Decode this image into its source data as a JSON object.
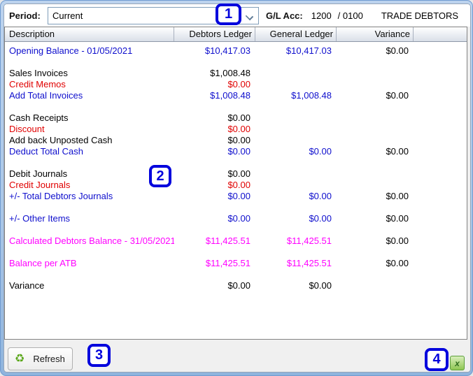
{
  "window": {
    "colors": {
      "blue": "#0e0ecd",
      "red": "#e00000",
      "magenta": "#ff00ff",
      "black": "#000000",
      "annotation": "#0202dd",
      "refresh_icon_green": "#58a618"
    },
    "topbar": {
      "period_label": "Period:",
      "period_value": "Current",
      "gl_acc_label": "G/L Acc:",
      "gl_acc_value": "1200",
      "gl_acc_sub": "/ 0100",
      "gl_acc_name": "TRADE DEBTORS"
    },
    "table": {
      "columns": [
        "Description",
        "Debtors Ledger",
        "General Ledger",
        "Variance"
      ],
      "rows": [
        {
          "label": "Opening Balance - 01/05/2021",
          "style": "blue",
          "debtors": "$10,417.03",
          "general": "$10,417.03",
          "variance": "$0.00"
        },
        {
          "spacer": true
        },
        {
          "label": "Sales Invoices",
          "style": "black",
          "debtors": "$1,008.48"
        },
        {
          "label": "Credit Memos",
          "style": "red",
          "debtors": "$0.00"
        },
        {
          "label": "Add Total Invoices",
          "style": "blue",
          "debtors": "$1,008.48",
          "general": "$1,008.48",
          "variance": "$0.00"
        },
        {
          "spacer": true
        },
        {
          "label": "Cash Receipts",
          "style": "black",
          "debtors": "$0.00"
        },
        {
          "label": "Discount",
          "style": "red",
          "debtors": "$0.00"
        },
        {
          "label": "Add back Unposted Cash",
          "style": "black",
          "debtors": "$0.00"
        },
        {
          "label": "Deduct Total Cash",
          "style": "blue",
          "debtors": "$0.00",
          "general": "$0.00",
          "variance": "$0.00"
        },
        {
          "spacer": true
        },
        {
          "label": "Debit Journals",
          "style": "black",
          "debtors": "$0.00"
        },
        {
          "label": "Credit Journals",
          "style": "red",
          "debtors": "$0.00"
        },
        {
          "label": "+/- Total Debtors Journals",
          "style": "blue",
          "debtors": "$0.00",
          "general": "$0.00",
          "variance": "$0.00"
        },
        {
          "spacer": true
        },
        {
          "label": "+/- Other Items",
          "style": "blue",
          "debtors": "$0.00",
          "general": "$0.00",
          "variance": "$0.00"
        },
        {
          "spacer": true
        },
        {
          "label": "Calculated Debtors Balance - 31/05/2021",
          "style": "magenta",
          "debtors": "$11,425.51",
          "general": "$11,425.51",
          "variance": "$0.00"
        },
        {
          "spacer": true
        },
        {
          "label": "Balance per ATB",
          "style": "magenta",
          "debtors": "$11,425.51",
          "general": "$11,425.51",
          "variance": "$0.00"
        },
        {
          "spacer": true
        },
        {
          "label": "Variance",
          "style": "black",
          "debtors": "$0.00",
          "general": "$0.00"
        }
      ]
    },
    "footer": {
      "refresh_label": "Refresh",
      "refresh_icon": "recycle-icon",
      "export_icon": "excel-export-icon",
      "excel_glyph": "x"
    },
    "annotations": {
      "n1": "1",
      "n2": "2",
      "n3": "3",
      "n4": "4"
    }
  }
}
